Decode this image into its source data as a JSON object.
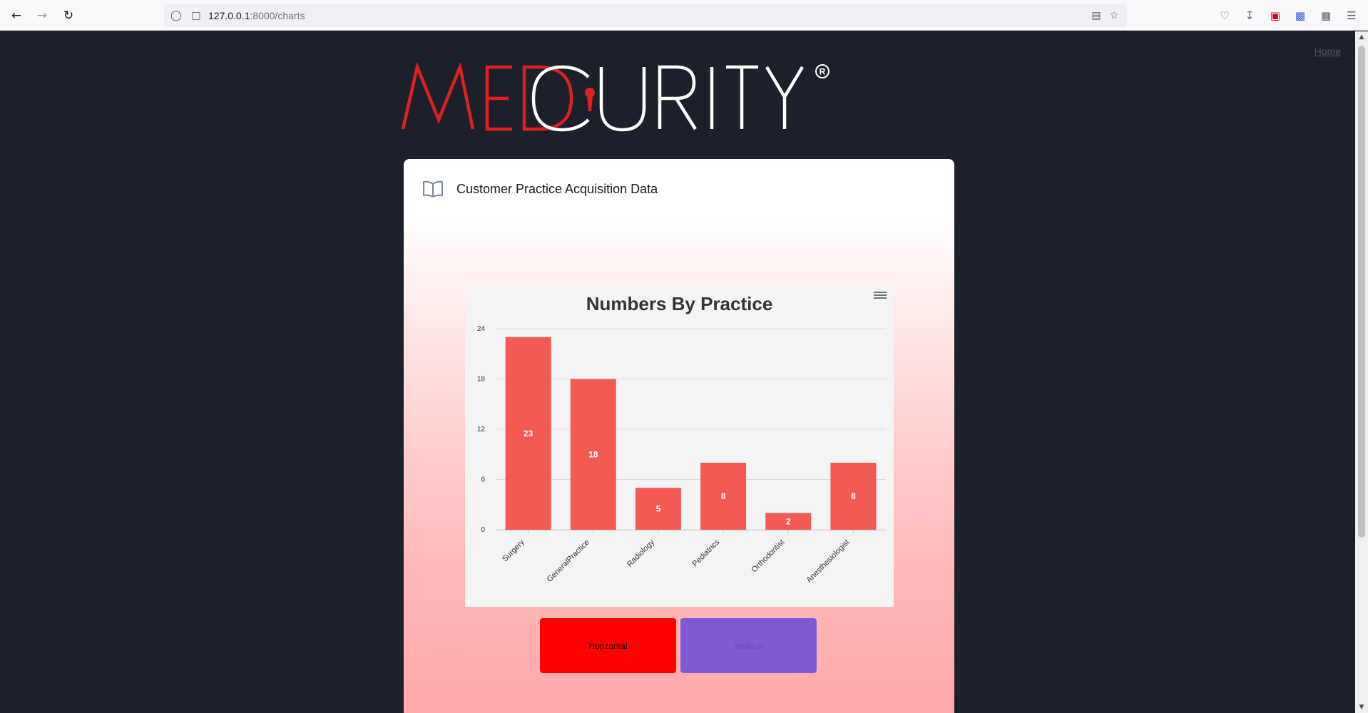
{
  "browser": {
    "url_host": "127.0.0.1",
    "url_path": ":8000/charts"
  },
  "nav": {
    "home_label": "Home"
  },
  "logo": {
    "part1": "MED",
    "part2": "CURITY",
    "mark": "®",
    "brand_red": "#e02020",
    "brand_white": "#ffffff"
  },
  "card": {
    "title": "Customer Practice Acquisition Data",
    "icon": "book-icon"
  },
  "chart_data": {
    "type": "bar",
    "title": "Numbers By Practice",
    "categories": [
      "Surgery",
      "GeneralPractice",
      "Radiology",
      "Pediatrics",
      "Orthodontist",
      "Anesthesiologist"
    ],
    "values": [
      23,
      18,
      5,
      8,
      2,
      8
    ],
    "yticks": [
      0,
      6,
      12,
      18,
      24
    ],
    "ylim": [
      0,
      24
    ],
    "grid": true,
    "bar_color": "#f25a52",
    "xlabel": "",
    "ylabel": ""
  },
  "buttons": {
    "horizontal_label": "Horizontal",
    "vertical_label": "Vertical",
    "horizontal_color": "#ff0000",
    "vertical_color": "#805ad5"
  }
}
